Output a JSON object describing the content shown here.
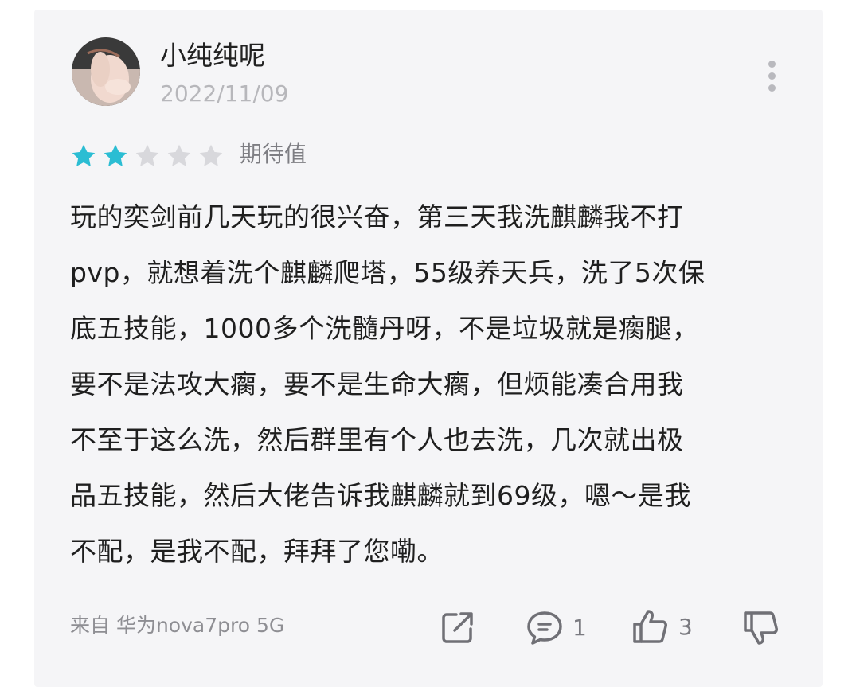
{
  "review": {
    "username": "小纯纯呢",
    "date": "2022/11/09",
    "rating": {
      "value": 2,
      "max": 5,
      "filled_color": "#2bbdd3",
      "empty_color": "#d8d8dc"
    },
    "rating_label": "期待值",
    "body_lines": [
      "玩的奕剑前几天玩的很兴奋，第三天我洗麒麟我不打",
      "pvp，就想着洗个麒麟爬塔，55级养天兵，洗了5次保",
      "底五技能，1000多个洗髓丹呀，不是垃圾就是瘸腿，",
      "要不是法攻大瘸，要不是生命大瘸，但烦能凑合用我",
      "不至于这么洗，然后群里有个人也去洗，几次就出极",
      "品五技能，然后大佬告诉我麒麟就到69级，嗯～是我",
      "不配，是我不配，拜拜了您嘞。"
    ],
    "device": "来自 华为nova7pro 5G",
    "actions": {
      "share_icon": "share-icon",
      "comment_icon": "comment-icon",
      "comment_count": "1",
      "like_icon": "thumbs-up-icon",
      "like_count": "3",
      "dislike_icon": "thumbs-down-icon"
    }
  }
}
